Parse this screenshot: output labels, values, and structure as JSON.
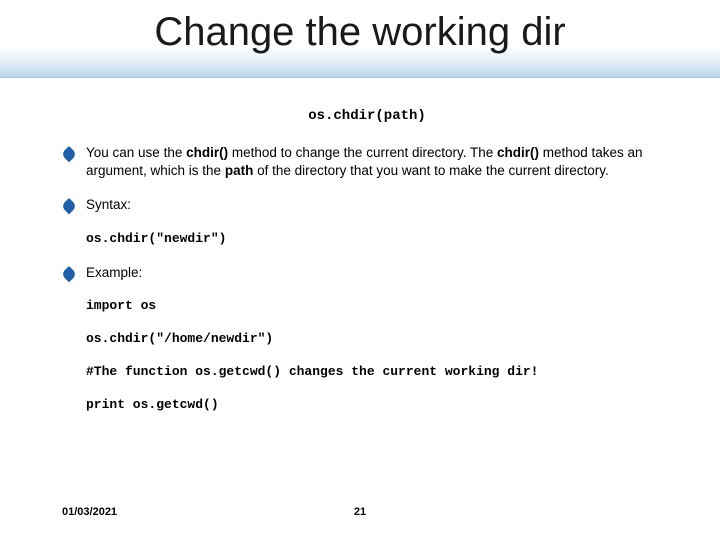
{
  "slide": {
    "title": "Change the working dir",
    "signature": "os.chdir(path)",
    "bullets": [
      {
        "html": "You can use the <b>chdir()</b> method to change the current directory. The <b>chdir()</b> method takes an argument, which is the <b>path</b> of the directory that you want to make the current directory."
      },
      {
        "html": "Syntax:"
      },
      {
        "html": "Example:"
      }
    ],
    "code": {
      "syntax": "os.chdir(\"newdir\")",
      "ex1": "import os",
      "ex2": "os.chdir(\"/home/newdir\")",
      "ex3": "#The function os.getcwd() changes the current working dir!",
      "ex4": "print os.getcwd()"
    },
    "footer": {
      "date": "01/03/2021",
      "page": "21"
    }
  }
}
